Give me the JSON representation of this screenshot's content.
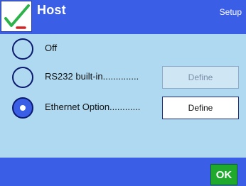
{
  "header": {
    "title": "Host",
    "mode": "Setup"
  },
  "options": [
    {
      "label": "Off",
      "selected": false
    },
    {
      "label": "RS232 built-in..............",
      "selected": false,
      "define_label": "Define",
      "define_enabled": false
    },
    {
      "label": "Ethernet Option............",
      "selected": true,
      "define_label": "Define",
      "define_enabled": true
    }
  ],
  "footer": {
    "ok_label": "OK"
  },
  "colors": {
    "accent": "#3b5ee6",
    "background": "#aed9f0",
    "ok": "#1faa2e",
    "check": "#2bb34a",
    "cross": "#d42424"
  }
}
